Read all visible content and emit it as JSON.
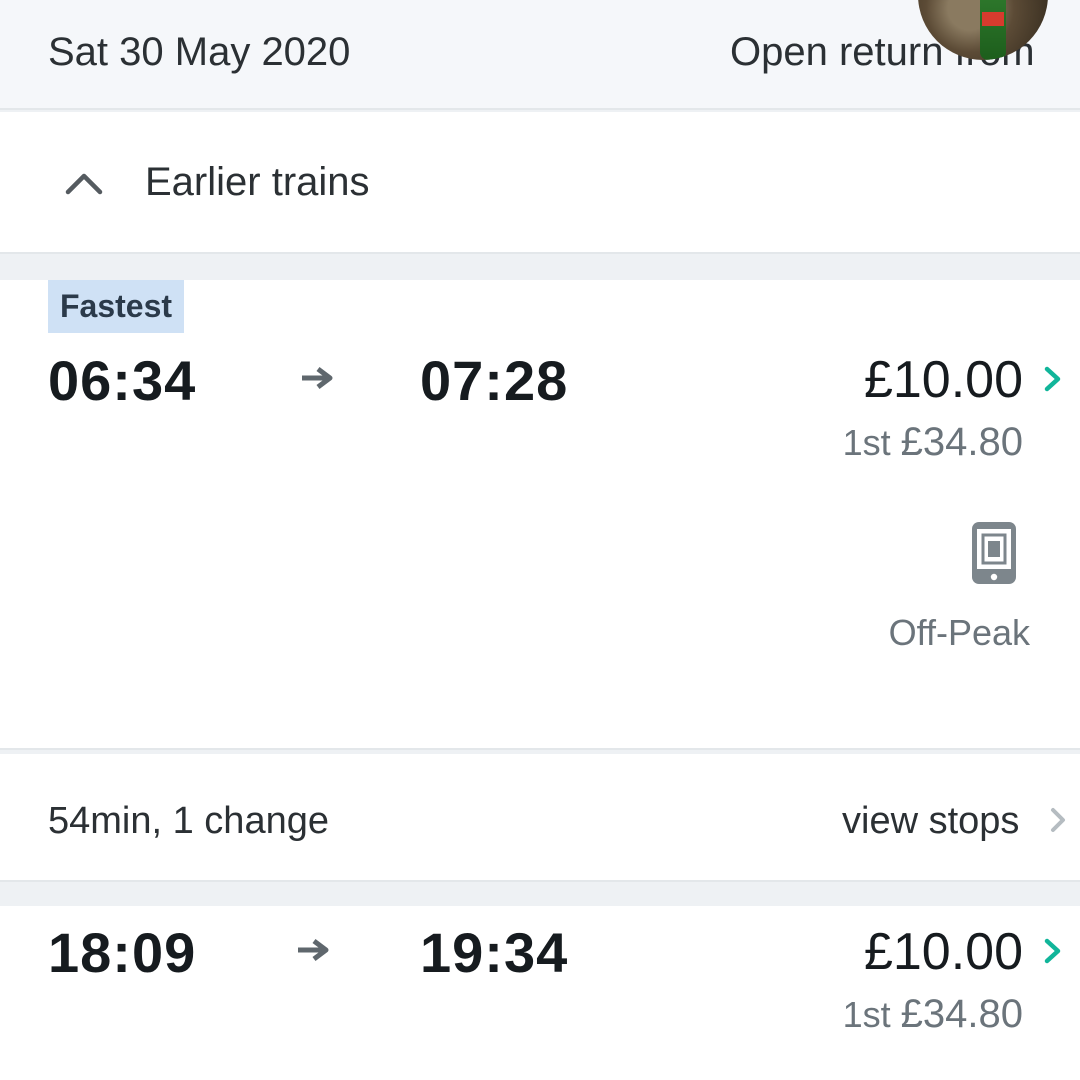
{
  "header": {
    "date": "Sat 30 May 2020",
    "open_return": "Open return from"
  },
  "earlier": {
    "label": "Earlier trains",
    "icon": "chevron-up-icon"
  },
  "journeys": [
    {
      "badge": "Fastest",
      "depart": "06:34",
      "arrive": "07:28",
      "price": "£10.00",
      "first_class_label": "1st",
      "first_class_price": "£34.80",
      "ticket_icon": "mobile-ticket-icon",
      "ticket_type": "Off-Peak",
      "duration": "54min, 1 change",
      "view_stops": "view stops"
    },
    {
      "depart": "18:09",
      "arrive": "19:34",
      "price": "£10.00",
      "first_class_label": "1st",
      "first_class_price": "£34.80"
    }
  ],
  "colors": {
    "accent": "#11b59a",
    "badge_bg": "#cfe1f5",
    "muted": "#6b747b",
    "header_bg": "#f5f7fa"
  }
}
